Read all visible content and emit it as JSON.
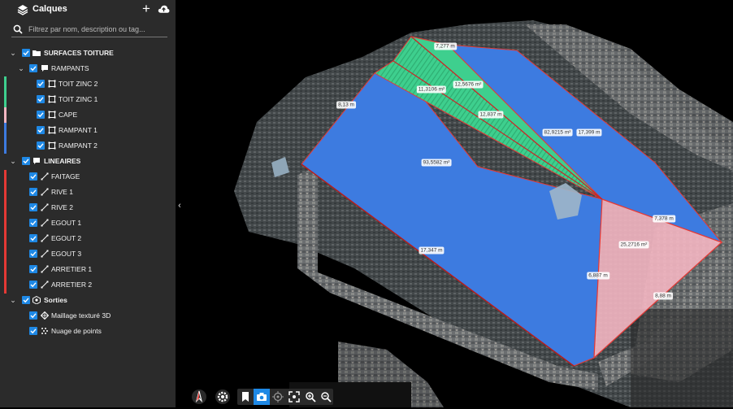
{
  "panel": {
    "title": "Calques",
    "add_label": "+",
    "search_placeholder": "Filtrez par nom, description ou tag..."
  },
  "tree": [
    {
      "label": "SURFACES TOITURE",
      "level": 0,
      "bold": true,
      "icon": "folder-icon",
      "caret": "v",
      "color": ""
    },
    {
      "label": "RAMPANTS",
      "level": 1,
      "bold": false,
      "icon": "comment-icon",
      "caret": "v",
      "color": ""
    },
    {
      "label": "TOIT ZINC 2",
      "level": 2,
      "bold": false,
      "icon": "polygon-icon",
      "caret": "",
      "color": "#3ecf8e"
    },
    {
      "label": "TOIT ZINC 1",
      "level": 2,
      "bold": false,
      "icon": "polygon-icon",
      "caret": "",
      "color": "#3ecf8e"
    },
    {
      "label": "CAPE",
      "level": 2,
      "bold": false,
      "icon": "polygon-icon",
      "caret": "",
      "color": "#f4b6c2"
    },
    {
      "label": "RAMPANT 1",
      "level": 2,
      "bold": false,
      "icon": "polygon-icon",
      "caret": "",
      "color": "#3d7be0"
    },
    {
      "label": "RAMPANT 2",
      "level": 2,
      "bold": false,
      "icon": "polygon-icon",
      "caret": "",
      "color": "#3d7be0"
    },
    {
      "label": "LINEAIRES",
      "level": 0,
      "bold": true,
      "icon": "comment-icon",
      "caret": "v",
      "color": ""
    },
    {
      "label": "FAITAGE",
      "level": 1,
      "bold": false,
      "icon": "line-icon",
      "caret": "",
      "color": "#e53935"
    },
    {
      "label": "RIVE 1",
      "level": 1,
      "bold": false,
      "icon": "line-icon",
      "caret": "",
      "color": "#e53935"
    },
    {
      "label": "RIVE 2",
      "level": 1,
      "bold": false,
      "icon": "line-icon",
      "caret": "",
      "color": "#e53935"
    },
    {
      "label": "EGOUT 1",
      "level": 1,
      "bold": false,
      "icon": "line-icon",
      "caret": "",
      "color": "#e53935"
    },
    {
      "label": "EGOUT 2",
      "level": 1,
      "bold": false,
      "icon": "line-icon",
      "caret": "",
      "color": "#e53935"
    },
    {
      "label": "EGOUT 3",
      "level": 1,
      "bold": false,
      "icon": "line-icon",
      "caret": "",
      "color": "#e53935"
    },
    {
      "label": "ARRETIER 1",
      "level": 1,
      "bold": false,
      "icon": "line-icon",
      "caret": "",
      "color": "#e53935"
    },
    {
      "label": "ARRETIER 2",
      "level": 1,
      "bold": false,
      "icon": "line-icon",
      "caret": "",
      "color": "#e53935"
    },
    {
      "label": "Sorties",
      "level": 0,
      "bold": true,
      "icon": "cube-icon",
      "caret": "v",
      "color": ""
    },
    {
      "label": "Maillage texturé 3D",
      "level": 1,
      "bold": false,
      "icon": "mesh-icon",
      "caret": "",
      "color": ""
    },
    {
      "label": "Nuage de points",
      "level": 1,
      "bold": false,
      "icon": "points-icon",
      "caret": "",
      "color": ""
    }
  ],
  "measurements": [
    {
      "text": "7,277 m"
    },
    {
      "text": "8,13 m"
    },
    {
      "text": "11,3106 m²"
    },
    {
      "text": "12,5676 m²"
    },
    {
      "text": "12,837 m"
    },
    {
      "text": "82,9215 m²"
    },
    {
      "text": "17,399 m"
    },
    {
      "text": "93,5582 m²"
    },
    {
      "text": "7,378 m"
    },
    {
      "text": "25,2716 m²"
    },
    {
      "text": "17,347 m"
    },
    {
      "text": "6,887 m"
    },
    {
      "text": "8,88 m"
    }
  ],
  "toolbar": {
    "tools": [
      "compass-icon",
      "settings-icon",
      "bookmark-icon",
      "camera-icon",
      "target-icon",
      "fit-icon",
      "zoom-in-icon",
      "zoom-out-icon"
    ],
    "active": "camera-icon"
  },
  "colors": {
    "sidebar_bg": "#2b2b2b",
    "checkbox": "#1e88e5",
    "roof_blue": "#3d7be0",
    "roof_green": "#3ecf8e",
    "roof_pink": "#f4b6c2",
    "edge_red": "#e53935"
  }
}
